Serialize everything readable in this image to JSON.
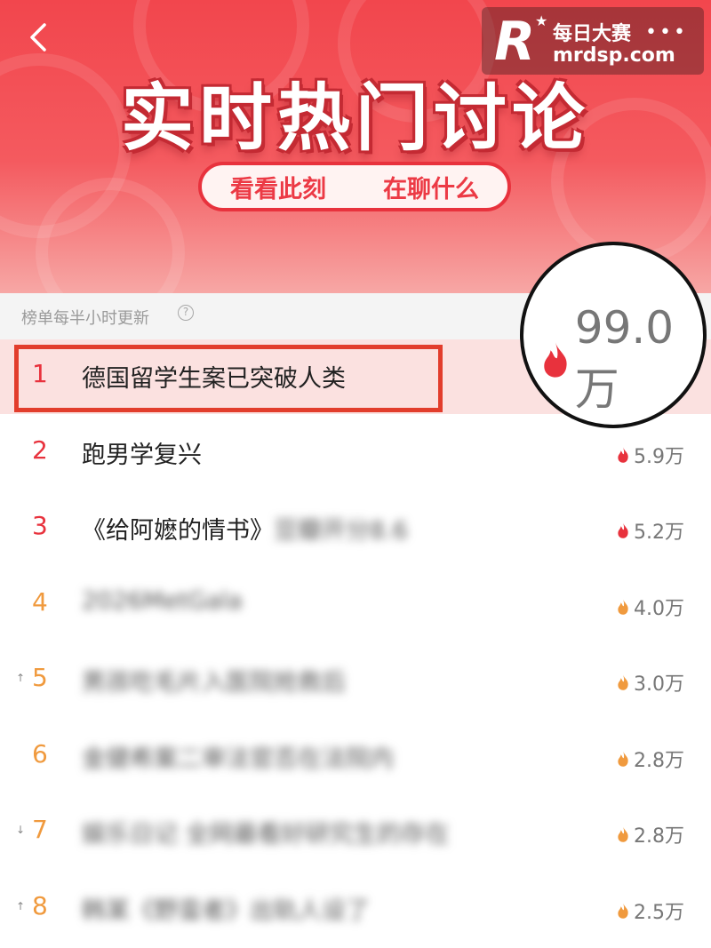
{
  "header": {
    "title": "实时热门讨论",
    "subtitle_left": "看看此刻",
    "subtitle_right": "在聊什么"
  },
  "watermark": {
    "logo_letter": "R",
    "title": "每日大赛",
    "dots": "•••",
    "url": "mrdsp.com"
  },
  "info": {
    "update_text": "榜单每半小时更新",
    "help": "?"
  },
  "callout": {
    "heat": "99.0万"
  },
  "list": [
    {
      "rank": "1",
      "title": "德国留学生案已突破人类",
      "heat": "",
      "trend": ""
    },
    {
      "rank": "2",
      "title": "跑男学复兴",
      "heat": "5.9万",
      "trend": ""
    },
    {
      "rank": "3",
      "title": "《给阿嬷的情书》",
      "blur": "豆瓣开分8.6",
      "heat": "5.2万",
      "trend": ""
    },
    {
      "rank": "4",
      "title": "",
      "blur": "2026MetGala",
      "heat": "4.0万",
      "trend": ""
    },
    {
      "rank": "5",
      "title": "",
      "blur": "男孩吃毛片入医院抢救后",
      "heat": "3.0万",
      "trend": "↑"
    },
    {
      "rank": "6",
      "title": "",
      "blur": "金健希案二审法官否在法院内",
      "heat": "2.8万",
      "trend": ""
    },
    {
      "rank": "7",
      "title": "",
      "blur": "娱乐日记 全网最看好研究生的存在",
      "heat": "2.8万",
      "trend": "↓"
    },
    {
      "rank": "8",
      "title": "",
      "blur": "韩某《野蛮者》出轨人设了",
      "heat": "2.5万",
      "trend": "↑"
    }
  ],
  "colors": {
    "accent": "#e8323d",
    "orange": "#f09a3e"
  }
}
